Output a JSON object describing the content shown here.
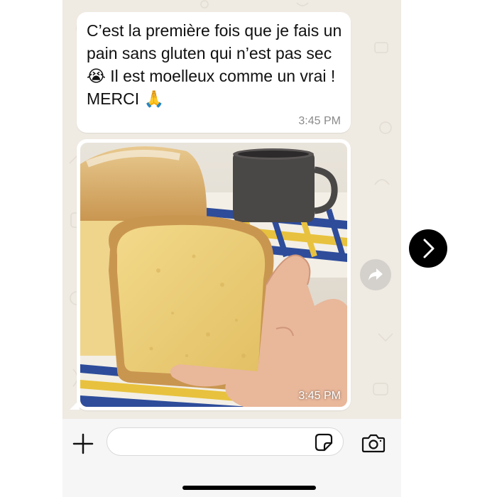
{
  "conversation": {
    "messages": [
      {
        "type": "text",
        "text": "C’est la première fois que je fais un pain sans gluten qui n’est pas sec 😭 Il est moelleux comme un vrai ! MERCI 🙏",
        "time": "3:45 PM"
      },
      {
        "type": "image",
        "image_description": "bread",
        "time": "3:45 PM"
      }
    ]
  },
  "icons": {
    "forward": "forward-arrow-icon",
    "plus": "plus-icon",
    "sticker": "sticker-icon",
    "camera": "camera-icon",
    "next": "chevron-right-icon"
  },
  "colors": {
    "chat_background": "#efeae2",
    "bubble": "#ffffff",
    "timestamp": "#8a8a8a",
    "next_button": "#000000"
  }
}
